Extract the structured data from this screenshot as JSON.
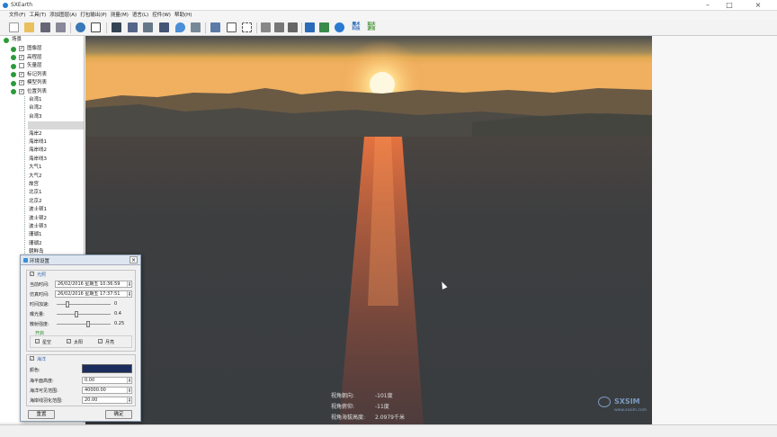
{
  "window": {
    "title": "SXEarth"
  },
  "menu": [
    "文件(F)",
    "工具(T)",
    "添加图层(A)",
    "打包输出(P)",
    "测量(M)",
    "语言(L)",
    "控件(W)",
    "帮助(H)"
  ],
  "toolbar": {
    "text_buttons": [
      "魔术\n科技",
      "延庆\n游览"
    ]
  },
  "tree": {
    "root": "场景",
    "layers": [
      "图像层",
      "高程层",
      "矢量层",
      "标记列表",
      "模型列表",
      "位置列表"
    ],
    "positions": [
      "台湾1",
      "台湾2",
      "台湾3",
      "",
      "海岸2",
      "海岸线1",
      "海岸线2",
      "海岸线3",
      "大气1",
      "大气2",
      "故宫",
      "北京1",
      "北京2",
      "波士顿1",
      "波士顿2",
      "波士顿3",
      "珊瑚1",
      "珊瑚2",
      "朝鲜岛"
    ]
  },
  "overlay": {
    "heading_label": "视角朝向:",
    "heading_value": "-101度",
    "pitch_label": "视角俯仰:",
    "pitch_value": "-11度",
    "altitude_label": "视角海拔高度:",
    "altitude_value": "2.0979千米",
    "watermark": "SXSIM",
    "watermark_url": "www.sxsim.com"
  },
  "dialog": {
    "title": "环境设置",
    "light": {
      "label": "光照",
      "current_time_label": "当前时间:",
      "current_time": "26/02/2016 星期五 10:36:59",
      "sim_time_label": "仿真时间:",
      "sim_time": "26/02/2016 星期五 17:37:51",
      "time_accel_label": "时间加速:",
      "time_accel": "0",
      "brightness_label": "曝光量:",
      "brightness": "0.4",
      "scatter_label": "散射强度:",
      "scatter": "0.25",
      "toggle_label": "开启",
      "options": [
        {
          "label": "星空",
          "checked": true
        },
        {
          "label": "太阳",
          "checked": true
        },
        {
          "label": "月亮",
          "checked": true
        }
      ]
    },
    "ocean": {
      "label": "海洋",
      "color_label": "颜色:",
      "color": "#1c2c5c",
      "sea_level_label": "海平面高度:",
      "sea_level": "0.00",
      "visible_range_label": "海洋可见范围:",
      "visible_range": "40000.00",
      "fade_range_label": "海岸线羽化范围:",
      "fade_range": "20.00"
    },
    "reset_label": "重置",
    "ok_label": "确定"
  },
  "colors": {
    "sky_top": "#4a4c4e",
    "sun": "#ffe9a0",
    "sea": "#3a3d40"
  }
}
